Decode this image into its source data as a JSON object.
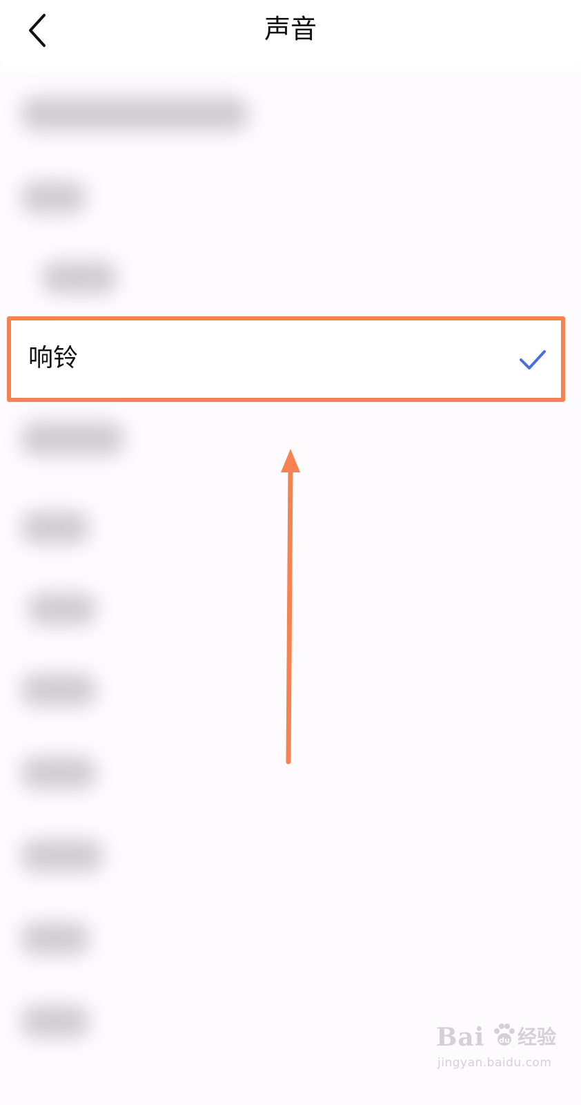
{
  "header": {
    "title": "声音",
    "back_icon": "chevron-left-icon"
  },
  "selected_option": {
    "label": "响铃",
    "selected": true,
    "check_icon": "checkmark-icon"
  },
  "annotation": {
    "highlight_color": "#f5824f",
    "arrow_color": "#f5824f"
  },
  "watermark": {
    "logo": "Bai",
    "logo_suffix": "du",
    "product": "经验",
    "url": "jingyan.baidu.com"
  },
  "colors": {
    "check": "#4a6fe0",
    "background": "#fdfbfd"
  }
}
